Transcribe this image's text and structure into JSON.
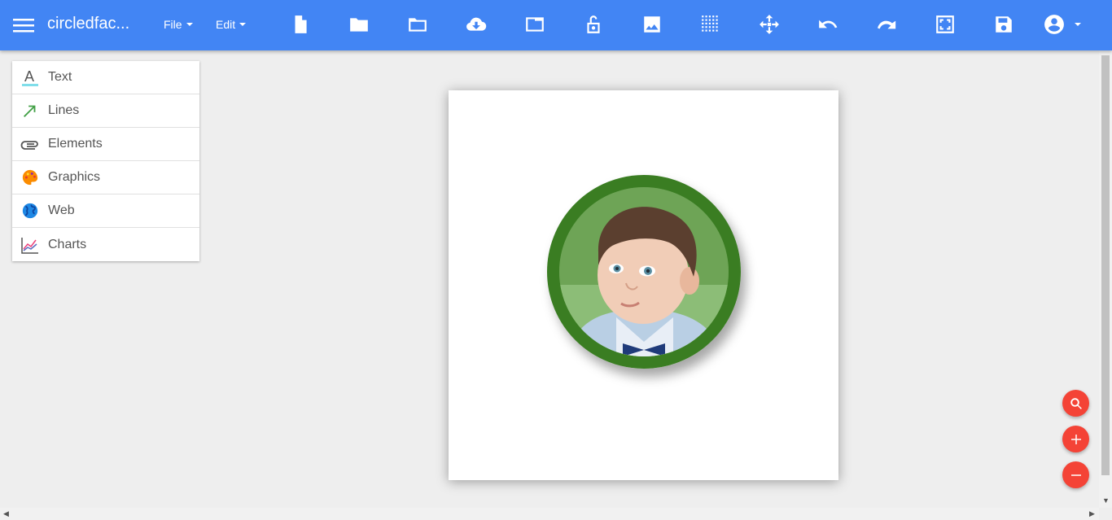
{
  "header": {
    "title": "circledfac...",
    "menus": [
      {
        "label": "File"
      },
      {
        "label": "Edit"
      }
    ],
    "toolbar_icons": [
      "new-file-icon",
      "open-folder-icon",
      "folder-outline-icon",
      "cloud-download-icon",
      "window-icon",
      "unlock-icon",
      "image-icon",
      "grid-icon",
      "move-icon",
      "undo-icon",
      "redo-icon",
      "fullscreen-icon",
      "save-icon",
      "account-icon"
    ]
  },
  "sidebar": {
    "items": [
      {
        "label": "Text",
        "icon": "text-icon"
      },
      {
        "label": "Lines",
        "icon": "arrow-line-icon"
      },
      {
        "label": "Elements",
        "icon": "paperclip-icon"
      },
      {
        "label": "Graphics",
        "icon": "palette-icon"
      },
      {
        "label": "Web",
        "icon": "globe-icon"
      },
      {
        "label": "Charts",
        "icon": "line-chart-icon"
      }
    ]
  },
  "canvas": {
    "frame_color": "#3a7d22"
  },
  "fabs": [
    "zoom-search-icon",
    "zoom-in-icon",
    "zoom-out-icon"
  ],
  "colors": {
    "header": "#4285f4",
    "fab": "#f44336"
  }
}
